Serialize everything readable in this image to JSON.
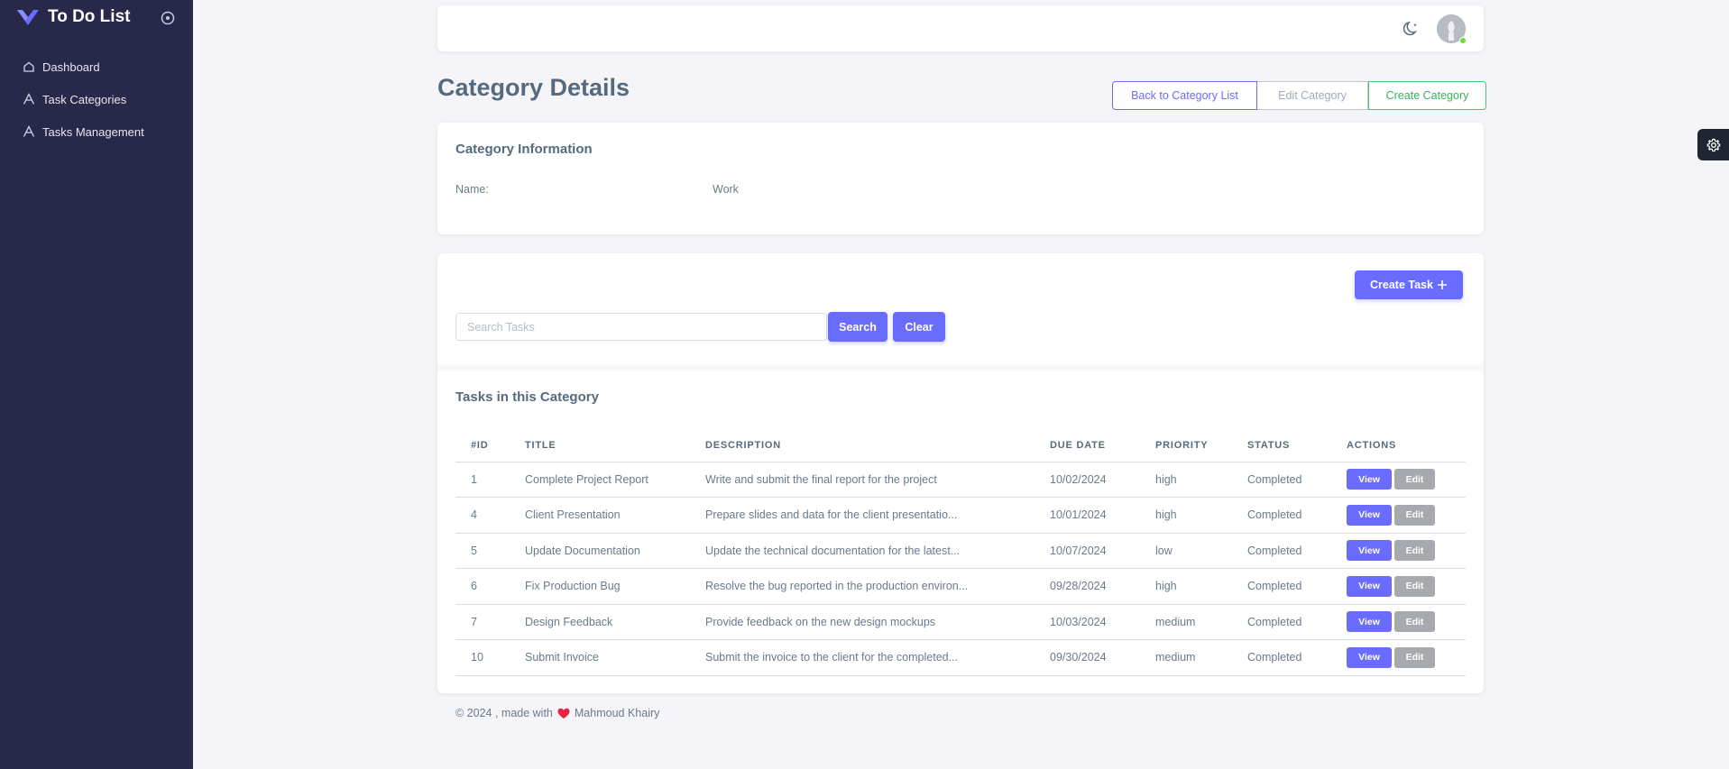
{
  "app": {
    "name": "To Do List"
  },
  "sidebar": {
    "items": [
      {
        "label": "Dashboard",
        "icon": "home-icon"
      },
      {
        "label": "Task Categories",
        "icon": "category-icon"
      },
      {
        "label": "Tasks Management",
        "icon": "tasks-icon"
      }
    ]
  },
  "header": {
    "title": "Category Details",
    "buttons": {
      "back": "Back to Category List",
      "edit": "Edit Category",
      "create": "Create Category"
    }
  },
  "category_info": {
    "title": "Category Information",
    "name_label": "Name:",
    "name_value": "Work"
  },
  "tasks_section": {
    "create_button": "Create Task",
    "search_placeholder": "Search Tasks",
    "search_button": "Search",
    "clear_button": "Clear",
    "title": "Tasks in this Category",
    "columns": [
      "#ID",
      "TITLE",
      "DESCRIPTION",
      "DUE DATE",
      "PRIORITY",
      "STATUS",
      "ACTIONS"
    ],
    "rows": [
      {
        "id": "1",
        "title": "Complete Project Report",
        "description": "Write and submit the final report for the project",
        "due": "10/02/2024",
        "priority": "high",
        "status": "Completed"
      },
      {
        "id": "4",
        "title": "Client Presentation",
        "description": "Prepare slides and data for the client presentatio...",
        "due": "10/01/2024",
        "priority": "high",
        "status": "Completed"
      },
      {
        "id": "5",
        "title": "Update Documentation",
        "description": "Update the technical documentation for the latest...",
        "due": "10/07/2024",
        "priority": "low",
        "status": "Completed"
      },
      {
        "id": "6",
        "title": "Fix Production Bug",
        "description": "Resolve the bug reported in the production environ...",
        "due": "09/28/2024",
        "priority": "high",
        "status": "Completed"
      },
      {
        "id": "7",
        "title": "Design Feedback",
        "description": "Provide feedback on the new design mockups",
        "due": "10/03/2024",
        "priority": "medium",
        "status": "Completed"
      },
      {
        "id": "10",
        "title": "Submit Invoice",
        "description": "Submit the invoice to the client for the completed...",
        "due": "09/30/2024",
        "priority": "medium",
        "status": "Completed"
      }
    ],
    "view_label": "View",
    "edit_label": "Edit"
  },
  "footer": {
    "prefix": "© 2024 , made with",
    "author": "Mahmoud Khairy"
  },
  "colors": {
    "primary": "#696cff",
    "sidebar_bg": "#28294a",
    "success": "#38b25d"
  }
}
